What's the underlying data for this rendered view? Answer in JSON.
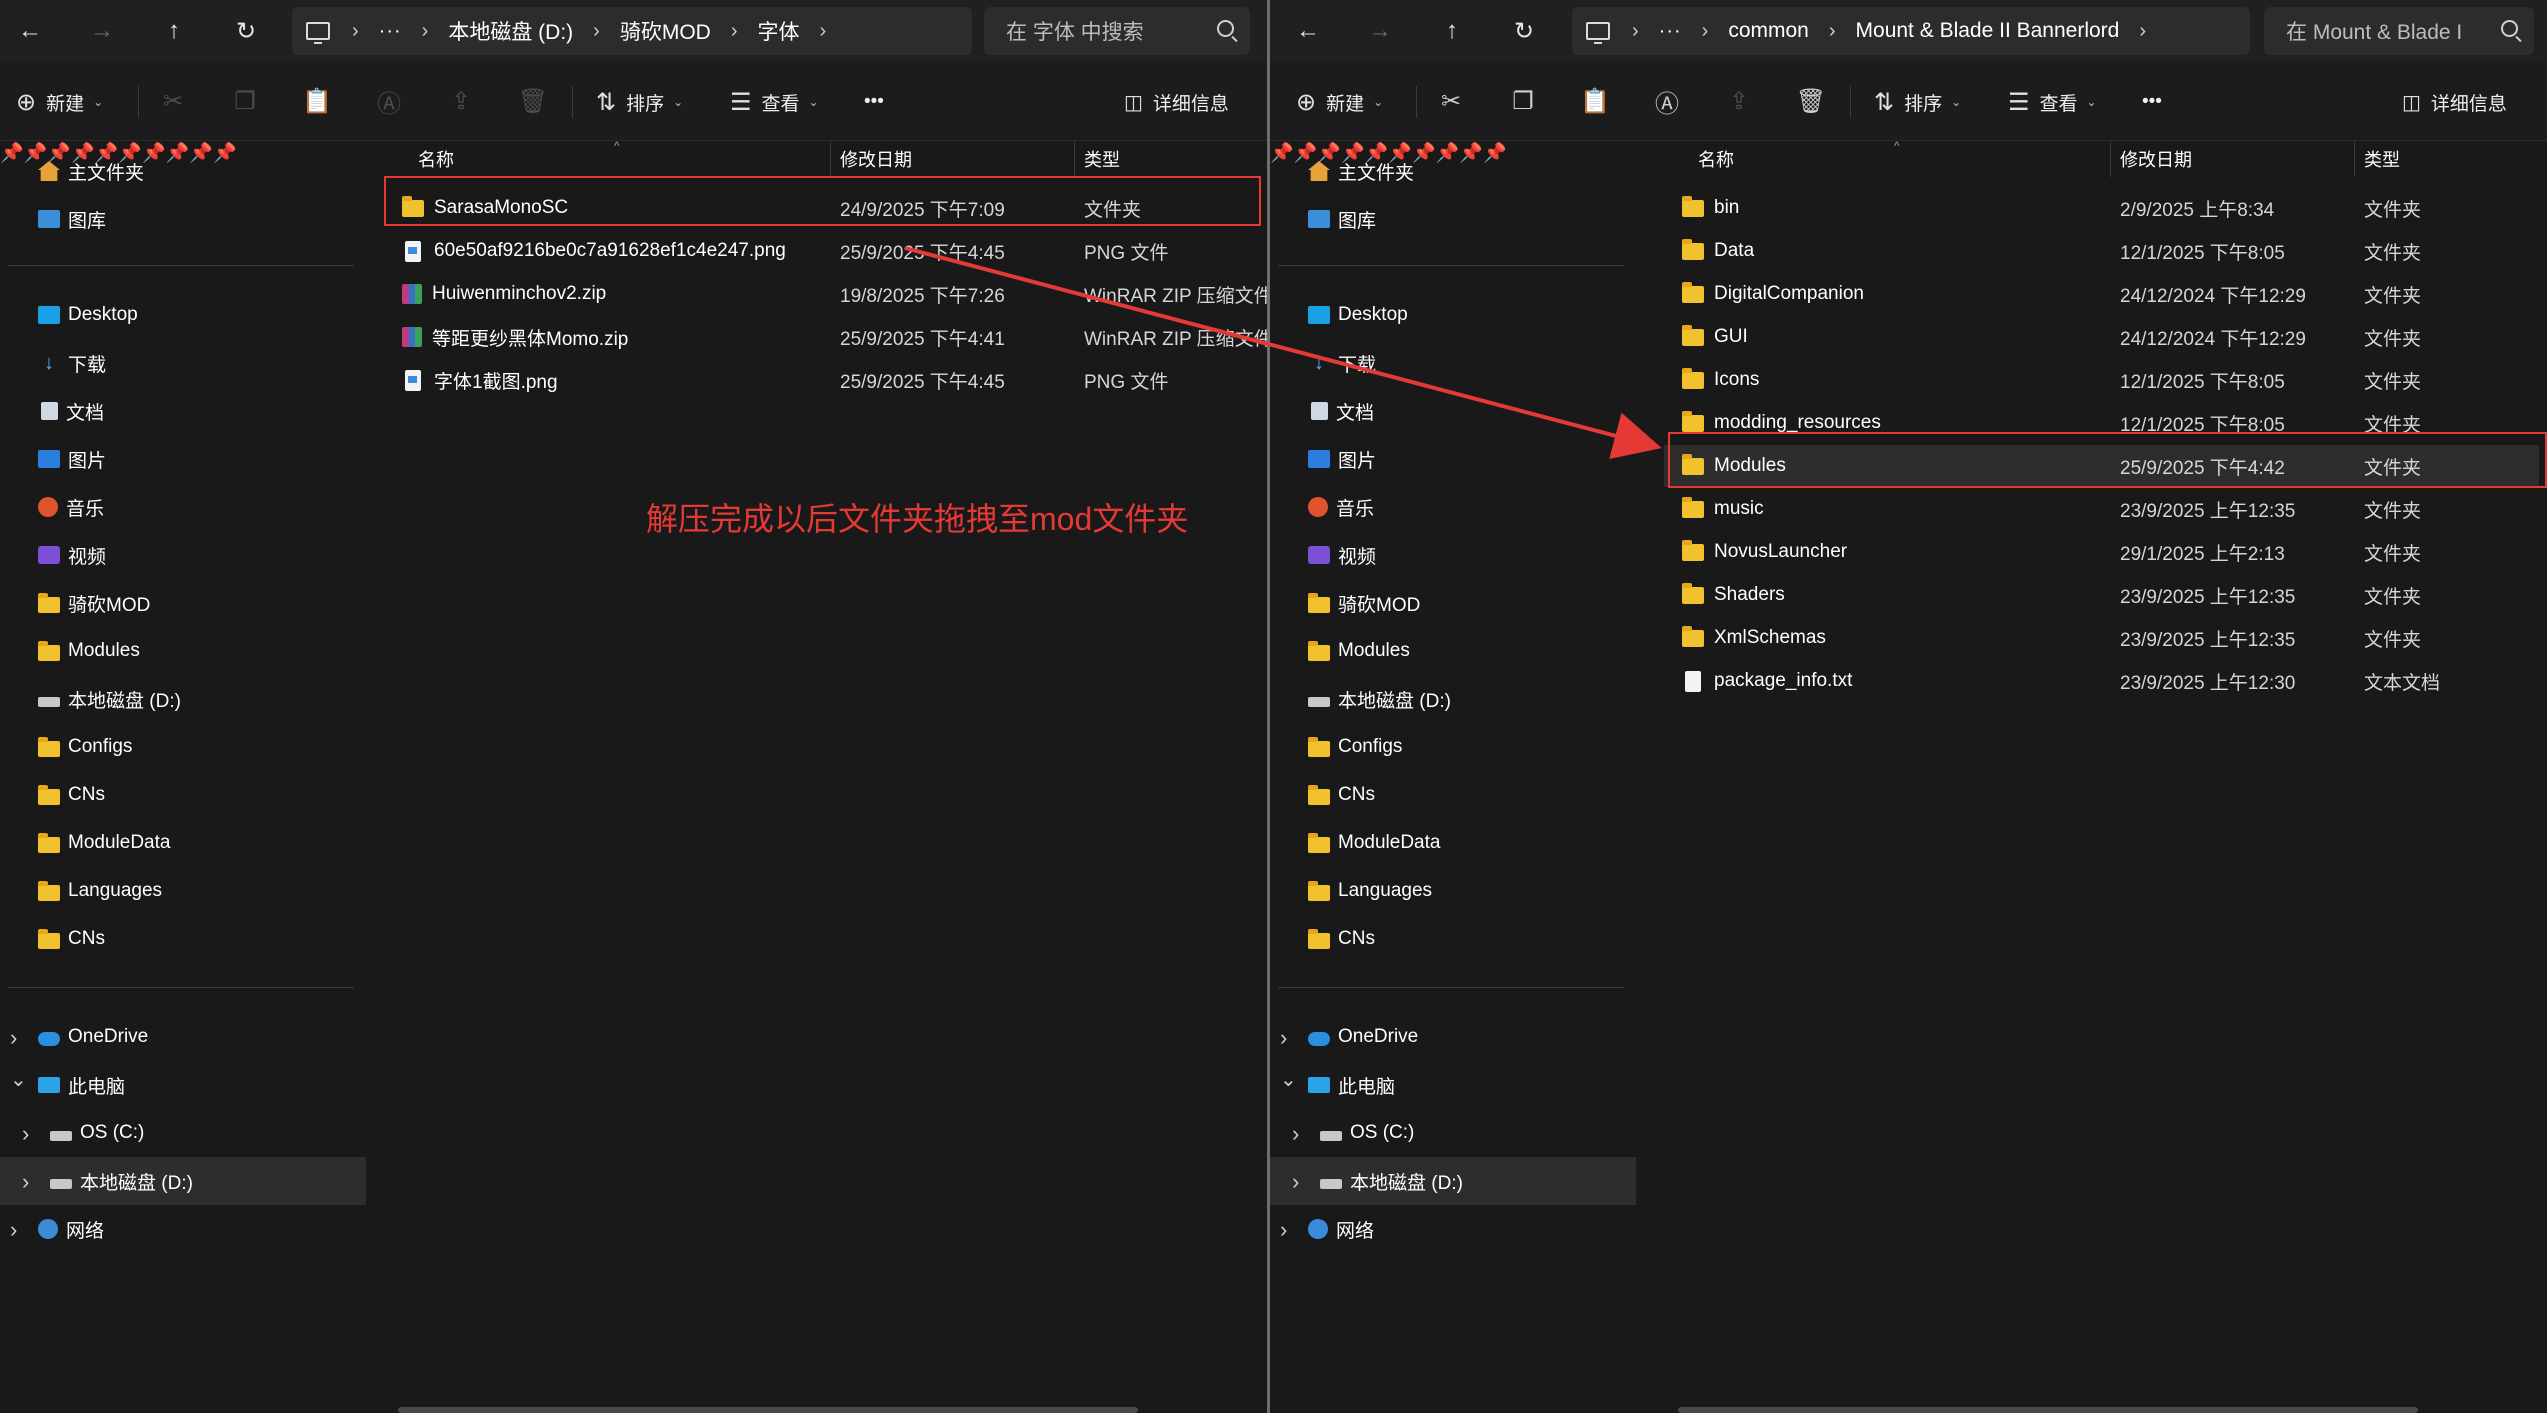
{
  "colors": {
    "annotation": "#e53935",
    "folder": "#f2c12e",
    "selection": "#2d2d2d"
  },
  "annotation_text": "解压完成以后文件夹拖拽至mod文件夹",
  "left": {
    "breadcrumb": [
      "本地磁盘 (D:)",
      "骑砍MOD",
      "字体"
    ],
    "search_placeholder": "在 字体 中搜索",
    "toolbar": {
      "new": "新建",
      "sort": "排序",
      "view": "查看",
      "more": "•••",
      "details": "详细信息"
    },
    "columns": {
      "name": "名称",
      "date": "修改日期",
      "type": "类型"
    },
    "files": [
      {
        "name": "SarasaMonoSC",
        "date": "24/9/2025 下午7:09",
        "type": "文件夹",
        "icon": "folder-icon"
      },
      {
        "name": "60e50af9216be0c7a91628ef1c4e247.png",
        "date": "25/9/2025 下午4:45",
        "type": "PNG 文件",
        "icon": "png-file-icon"
      },
      {
        "name": "Huiwenminchov2.zip",
        "date": "19/8/2025 下午7:26",
        "type": "WinRAR ZIP 压缩文件",
        "icon": "zip-file-icon"
      },
      {
        "name": "等距更纱黑体Momo.zip",
        "date": "25/9/2025 下午4:41",
        "type": "WinRAR ZIP 压缩文件",
        "icon": "zip-file-icon"
      },
      {
        "name": "字体1截图.png",
        "date": "25/9/2025 下午4:45",
        "type": "PNG 文件",
        "icon": "png-file-icon"
      }
    ]
  },
  "right": {
    "breadcrumb": [
      "common",
      "Mount & Blade II Bannerlord"
    ],
    "search_placeholder": "在 Mount & Blade I",
    "toolbar": {
      "new": "新建",
      "sort": "排序",
      "view": "查看",
      "more": "•••",
      "details": "详细信息"
    },
    "columns": {
      "name": "名称",
      "date": "修改日期",
      "type": "类型"
    },
    "files": [
      {
        "name": "bin",
        "date": "2/9/2025 上午8:34",
        "type": "文件夹",
        "icon": "folder-icon"
      },
      {
        "name": "Data",
        "date": "12/1/2025 下午8:05",
        "type": "文件夹",
        "icon": "folder-icon"
      },
      {
        "name": "DigitalCompanion",
        "date": "24/12/2024 下午12:29",
        "type": "文件夹",
        "icon": "folder-icon"
      },
      {
        "name": "GUI",
        "date": "24/12/2024 下午12:29",
        "type": "文件夹",
        "icon": "folder-icon"
      },
      {
        "name": "Icons",
        "date": "12/1/2025 下午8:05",
        "type": "文件夹",
        "icon": "folder-icon"
      },
      {
        "name": "modding_resources",
        "date": "12/1/2025 下午8:05",
        "type": "文件夹",
        "icon": "folder-icon"
      },
      {
        "name": "Modules",
        "date": "25/9/2025 下午4:42",
        "type": "文件夹",
        "icon": "folder-icon"
      },
      {
        "name": "music",
        "date": "23/9/2025 上午12:35",
        "type": "文件夹",
        "icon": "folder-icon"
      },
      {
        "name": "NovusLauncher",
        "date": "29/1/2025 上午2:13",
        "type": "文件夹",
        "icon": "folder-icon"
      },
      {
        "name": "Shaders",
        "date": "23/9/2025 上午12:35",
        "type": "文件夹",
        "icon": "folder-icon"
      },
      {
        "name": "XmlSchemas",
        "date": "23/9/2025 上午12:35",
        "type": "文件夹",
        "icon": "folder-icon"
      },
      {
        "name": "package_info.txt",
        "date": "23/9/2025 上午12:30",
        "type": "文本文档",
        "icon": "text-file-icon"
      }
    ]
  },
  "sidebar": {
    "top": [
      {
        "label": "主文件夹",
        "icon": "home-icon"
      },
      {
        "label": "图库",
        "icon": "gallery-icon"
      }
    ],
    "quick": [
      {
        "label": "Desktop",
        "icon": "desktop-icon",
        "pinned": true
      },
      {
        "label": "下载",
        "icon": "download-icon",
        "pinned": true
      },
      {
        "label": "文档",
        "icon": "documents-icon",
        "pinned": true
      },
      {
        "label": "图片",
        "icon": "pictures-icon",
        "pinned": true
      },
      {
        "label": "音乐",
        "icon": "music-icon",
        "pinned": true
      },
      {
        "label": "视频",
        "icon": "videos-icon",
        "pinned": true
      },
      {
        "label": "骑砍MOD",
        "icon": "folder-icon",
        "pinned": true
      },
      {
        "label": "Modules",
        "icon": "folder-icon",
        "pinned": true
      },
      {
        "label": "本地磁盘 (D:)",
        "icon": "drive-icon",
        "pinned": true
      },
      {
        "label": "Configs",
        "icon": "folder-icon",
        "pinned": true
      },
      {
        "label": "CNs",
        "icon": "folder-icon",
        "pinned": false
      },
      {
        "label": "ModuleData",
        "icon": "folder-icon",
        "pinned": false
      },
      {
        "label": "Languages",
        "icon": "folder-icon",
        "pinned": false
      },
      {
        "label": "CNs",
        "icon": "folder-icon",
        "pinned": false
      }
    ],
    "tree": [
      {
        "label": "OneDrive",
        "icon": "onedrive-icon",
        "chevron": "›",
        "indent": 0
      },
      {
        "label": "此电脑",
        "icon": "pc-icon",
        "chevron": "⌄",
        "indent": 0
      },
      {
        "label": "OS (C:)",
        "icon": "drive-icon",
        "chevron": "›",
        "indent": 1
      },
      {
        "label": "本地磁盘 (D:)",
        "icon": "drive-icon",
        "chevron": "›",
        "indent": 1,
        "selected": true
      },
      {
        "label": "网络",
        "icon": "network-icon",
        "chevron": "›",
        "indent": 0
      }
    ]
  }
}
